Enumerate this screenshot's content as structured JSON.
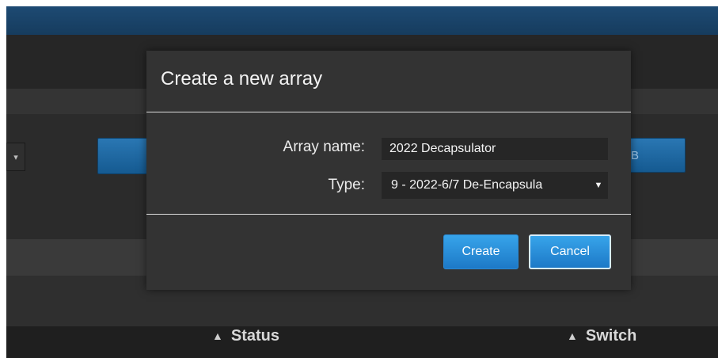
{
  "background": {
    "right_button_text": "B",
    "select_caret": "▾"
  },
  "table": {
    "headers": [
      {
        "label": "Status",
        "icon": "sort-icon"
      },
      {
        "label": "Switch",
        "icon": "sort-icon"
      }
    ]
  },
  "dialog": {
    "title": "Create a new array",
    "fields": {
      "name_label": "Array name:",
      "name_value": "2022 Decapsulator",
      "type_label": "Type:",
      "type_value": "9 - 2022-6/7 De-Encapsula",
      "type_caret": "▼"
    },
    "buttons": {
      "create": "Create",
      "cancel": "Cancel"
    }
  },
  "colors": {
    "accent": "#1f8ad6",
    "topbar": "#1b4570",
    "dialog_bg": "#333333"
  }
}
